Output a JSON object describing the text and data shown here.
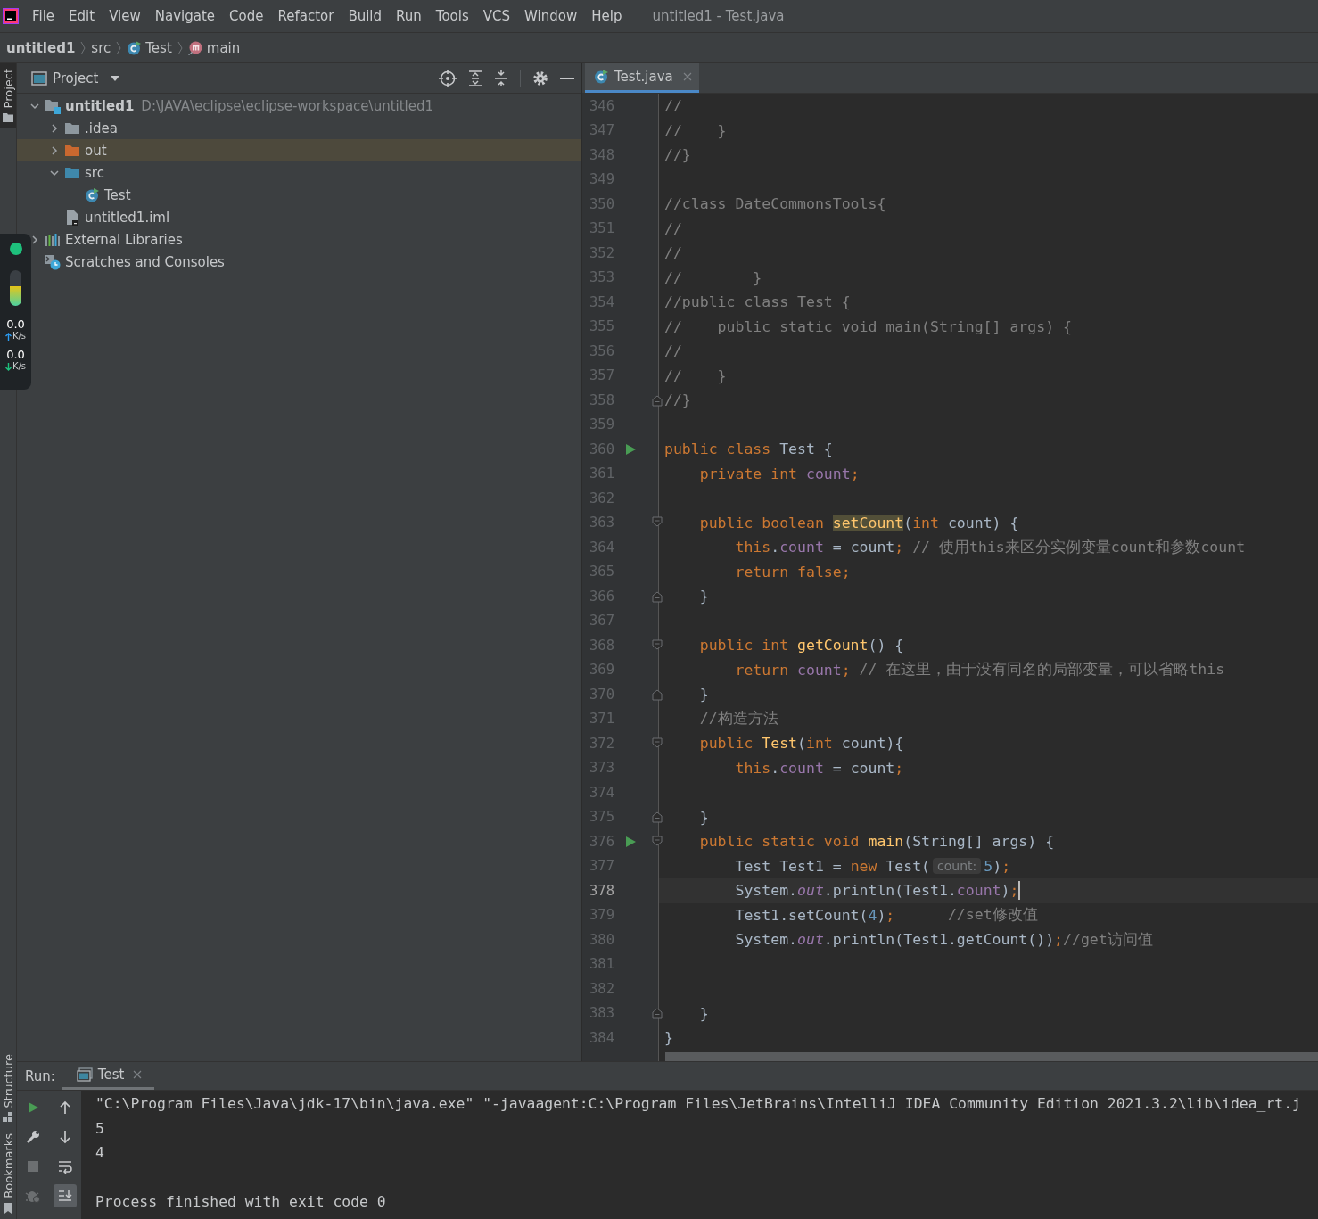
{
  "menu_bar": {
    "items": [
      "File",
      "Edit",
      "View",
      "Navigate",
      "Code",
      "Refactor",
      "Build",
      "Run",
      "Tools",
      "VCS",
      "Window",
      "Help"
    ],
    "window_title": "untitled1 - Test.java"
  },
  "breadcrumbs": [
    {
      "kind": "project",
      "label": "untitled1"
    },
    {
      "kind": "folder",
      "label": "src"
    },
    {
      "kind": "class",
      "label": "Test"
    },
    {
      "kind": "method",
      "label": "main"
    }
  ],
  "left_stripe": {
    "tabs": [
      {
        "label": "Project",
        "kind": "top",
        "selected": true
      },
      {
        "label": "Structure",
        "kind": "bottom",
        "selected": false
      },
      {
        "label": "Bookmarks",
        "kind": "bottom",
        "selected": false
      }
    ]
  },
  "project_panel": {
    "title": "Project",
    "tree": [
      {
        "kind": "module",
        "label": "untitled1",
        "path": "D:\\JAVA\\eclipse\\eclipse-workspace\\untitled1",
        "expanded": true,
        "selected": false,
        "children": [
          {
            "kind": "folder",
            "label": ".idea",
            "expanded": false,
            "selected": false
          },
          {
            "kind": "excluded-folder",
            "label": "out",
            "expanded": false,
            "selected": true
          },
          {
            "kind": "source-folder",
            "label": "src",
            "expanded": true,
            "selected": false,
            "children": [
              {
                "kind": "class",
                "label": "Test",
                "selected": false
              }
            ]
          },
          {
            "kind": "module-file",
            "label": "untitled1.iml",
            "selected": false
          }
        ]
      },
      {
        "kind": "libraries",
        "label": "External Libraries",
        "expanded": false,
        "selected": false
      },
      {
        "kind": "scratches",
        "label": "Scratches and Consoles",
        "selected": false
      }
    ]
  },
  "editor": {
    "tabs": [
      {
        "label": "Test.java",
        "selected": true
      }
    ],
    "lines": [
      {
        "number": "346",
        "current": false,
        "run": false,
        "fold_start": false,
        "fold_end": false,
        "spans": [
          {
            "kind": "comment",
            "text": "//"
          }
        ]
      },
      {
        "number": "347",
        "current": false,
        "run": false,
        "fold_start": false,
        "fold_end": false,
        "spans": [
          {
            "kind": "comment",
            "text": "//    }"
          }
        ]
      },
      {
        "number": "348",
        "current": false,
        "run": false,
        "fold_start": false,
        "fold_end": false,
        "spans": [
          {
            "kind": "comment",
            "text": "//}"
          }
        ]
      },
      {
        "number": "349",
        "current": false,
        "run": false,
        "fold_start": false,
        "fold_end": false
      },
      {
        "number": "350",
        "current": false,
        "run": false,
        "fold_start": false,
        "fold_end": false,
        "spans": [
          {
            "kind": "comment",
            "text": "//class DateCommonsTools{"
          }
        ]
      },
      {
        "number": "351",
        "current": false,
        "run": false,
        "fold_start": false,
        "fold_end": false,
        "spans": [
          {
            "kind": "comment",
            "text": "//"
          }
        ]
      },
      {
        "number": "352",
        "current": false,
        "run": false,
        "fold_start": false,
        "fold_end": false,
        "spans": [
          {
            "kind": "comment",
            "text": "//"
          }
        ]
      },
      {
        "number": "353",
        "current": false,
        "run": false,
        "fold_start": false,
        "fold_end": false,
        "spans": [
          {
            "kind": "comment",
            "text": "//        }"
          }
        ]
      },
      {
        "number": "354",
        "current": false,
        "run": false,
        "fold_start": false,
        "fold_end": false,
        "spans": [
          {
            "kind": "comment",
            "text": "//public class Test {"
          }
        ]
      },
      {
        "number": "355",
        "current": false,
        "run": false,
        "fold_start": false,
        "fold_end": false,
        "spans": [
          {
            "kind": "comment",
            "text": "//    public static void main(String[] args) {"
          }
        ]
      },
      {
        "number": "356",
        "current": false,
        "run": false,
        "fold_start": false,
        "fold_end": false,
        "spans": [
          {
            "kind": "comment",
            "text": "//"
          }
        ]
      },
      {
        "number": "357",
        "current": false,
        "run": false,
        "fold_start": false,
        "fold_end": false,
        "spans": [
          {
            "kind": "comment",
            "text": "//    }"
          }
        ]
      },
      {
        "number": "358",
        "current": false,
        "run": false,
        "fold_start": false,
        "fold_end": true,
        "spans": [
          {
            "kind": "comment",
            "text": "//}"
          }
        ]
      },
      {
        "number": "359",
        "current": false,
        "run": false,
        "fold_start": false,
        "fold_end": false
      },
      {
        "number": "360",
        "current": false,
        "run": true,
        "fold_start": false,
        "fold_end": false,
        "spans": [
          {
            "kind": "keyword",
            "text": "public class "
          },
          {
            "kind": "plain",
            "text": "Test {"
          }
        ]
      },
      {
        "number": "361",
        "current": false,
        "run": false,
        "fold_start": false,
        "fold_end": false,
        "spans": [
          {
            "kind": "keyword",
            "text": "    private int "
          },
          {
            "kind": "field",
            "text": "count"
          },
          {
            "kind": "keyword",
            "text": ";"
          }
        ]
      },
      {
        "number": "362",
        "current": false,
        "run": false,
        "fold_start": false,
        "fold_end": false
      },
      {
        "number": "363",
        "current": false,
        "run": false,
        "fold_start": true,
        "fold_end": false,
        "spans": [
          {
            "kind": "keyword",
            "text": "    public boolean "
          },
          {
            "kind": "highlight",
            "text": "setCount"
          },
          {
            "kind": "plain",
            "text": "("
          },
          {
            "kind": "keyword",
            "text": "int "
          },
          {
            "kind": "plain",
            "text": "count) {"
          }
        ]
      },
      {
        "number": "364",
        "current": false,
        "run": false,
        "fold_start": false,
        "fold_end": false,
        "spans": [
          {
            "kind": "keyword",
            "text": "        this"
          },
          {
            "kind": "plain",
            "text": "."
          },
          {
            "kind": "field",
            "text": "count"
          },
          {
            "kind": "plain",
            "text": " = count"
          },
          {
            "kind": "keyword",
            "text": ";"
          },
          {
            "kind": "comment",
            "text": " // 使用this来区分实例变量count和参数count"
          }
        ]
      },
      {
        "number": "365",
        "current": false,
        "run": false,
        "fold_start": false,
        "fold_end": false,
        "spans": [
          {
            "kind": "keyword",
            "text": "        return false;"
          }
        ]
      },
      {
        "number": "366",
        "current": false,
        "run": false,
        "fold_start": false,
        "fold_end": true,
        "spans": [
          {
            "kind": "plain",
            "text": "    }"
          }
        ]
      },
      {
        "number": "367",
        "current": false,
        "run": false,
        "fold_start": false,
        "fold_end": false
      },
      {
        "number": "368",
        "current": false,
        "run": false,
        "fold_start": true,
        "fold_end": false,
        "spans": [
          {
            "kind": "keyword",
            "text": "    public int "
          },
          {
            "kind": "declaration",
            "text": "getCount"
          },
          {
            "kind": "plain",
            "text": "() {"
          }
        ]
      },
      {
        "number": "369",
        "current": false,
        "run": false,
        "fold_start": false,
        "fold_end": false,
        "spans": [
          {
            "kind": "keyword",
            "text": "        return "
          },
          {
            "kind": "field",
            "text": "count"
          },
          {
            "kind": "keyword",
            "text": ";"
          },
          {
            "kind": "comment",
            "text": " // 在这里，由于没有同名的局部变量，可以省略this"
          }
        ]
      },
      {
        "number": "370",
        "current": false,
        "run": false,
        "fold_start": false,
        "fold_end": true,
        "spans": [
          {
            "kind": "plain",
            "text": "    }"
          }
        ]
      },
      {
        "number": "371",
        "current": false,
        "run": false,
        "fold_start": false,
        "fold_end": false,
        "spans": [
          {
            "kind": "comment",
            "text": "    //构造方法"
          }
        ]
      },
      {
        "number": "372",
        "current": false,
        "run": false,
        "fold_start": true,
        "fold_end": false,
        "spans": [
          {
            "kind": "keyword",
            "text": "    public "
          },
          {
            "kind": "declaration",
            "text": "Test"
          },
          {
            "kind": "plain",
            "text": "("
          },
          {
            "kind": "keyword",
            "text": "int "
          },
          {
            "kind": "plain",
            "text": "count){"
          }
        ]
      },
      {
        "number": "373",
        "current": false,
        "run": false,
        "fold_start": false,
        "fold_end": false,
        "spans": [
          {
            "kind": "keyword",
            "text": "        this"
          },
          {
            "kind": "plain",
            "text": "."
          },
          {
            "kind": "field",
            "text": "count"
          },
          {
            "kind": "plain",
            "text": " = count"
          },
          {
            "kind": "keyword",
            "text": ";"
          }
        ]
      },
      {
        "number": "374",
        "current": false,
        "run": false,
        "fold_start": false,
        "fold_end": false
      },
      {
        "number": "375",
        "current": false,
        "run": false,
        "fold_start": false,
        "fold_end": true,
        "spans": [
          {
            "kind": "plain",
            "text": "    }"
          }
        ]
      },
      {
        "number": "376",
        "current": false,
        "run": true,
        "fold_start": true,
        "fold_end": false,
        "spans": [
          {
            "kind": "keyword",
            "text": "    public static void "
          },
          {
            "kind": "declaration",
            "text": "main"
          },
          {
            "kind": "plain",
            "text": "(String[] args) {"
          }
        ]
      },
      {
        "number": "377",
        "current": false,
        "run": false,
        "fold_start": false,
        "fold_end": false,
        "spans": [
          {
            "kind": "plain",
            "text": "        Test Test1 = "
          },
          {
            "kind": "keyword",
            "text": "new"
          },
          {
            "kind": "plain",
            "text": " Test("
          },
          {
            "kind": "hint",
            "text": "count:"
          },
          {
            "kind": "number",
            "text": "5"
          },
          {
            "kind": "plain",
            "text": ")"
          },
          {
            "kind": "keyword",
            "text": ";"
          }
        ]
      },
      {
        "number": "378",
        "current": true,
        "run": false,
        "fold_start": false,
        "fold_end": false,
        "spans": [
          {
            "kind": "plain",
            "text": "        System."
          },
          {
            "kind": "static",
            "text": "out"
          },
          {
            "kind": "plain",
            "text": ".println(Test1."
          },
          {
            "kind": "field",
            "text": "count"
          },
          {
            "kind": "plain",
            "text": ")"
          },
          {
            "kind": "keyword",
            "text": ";"
          }
        ]
      },
      {
        "number": "379",
        "current": false,
        "run": false,
        "fold_start": false,
        "fold_end": false,
        "spans": [
          {
            "kind": "plain",
            "text": "        Test1.setCount("
          },
          {
            "kind": "number",
            "text": "4"
          },
          {
            "kind": "plain",
            "text": ")"
          },
          {
            "kind": "keyword",
            "text": ";"
          },
          {
            "kind": "comment",
            "text": "      //set修改值"
          }
        ]
      },
      {
        "number": "380",
        "current": false,
        "run": false,
        "fold_start": false,
        "fold_end": false,
        "spans": [
          {
            "kind": "plain",
            "text": "        System."
          },
          {
            "kind": "static",
            "text": "out"
          },
          {
            "kind": "plain",
            "text": ".println(Test1.getCount())"
          },
          {
            "kind": "keyword",
            "text": ";"
          },
          {
            "kind": "comment",
            "text": "//get访问值"
          }
        ]
      },
      {
        "number": "381",
        "current": false,
        "run": false,
        "fold_start": false,
        "fold_end": false
      },
      {
        "number": "382",
        "current": false,
        "run": false,
        "fold_start": false,
        "fold_end": false
      },
      {
        "number": "383",
        "current": false,
        "run": false,
        "fold_start": false,
        "fold_end": true,
        "spans": [
          {
            "kind": "plain",
            "text": "    }"
          }
        ]
      },
      {
        "number": "384",
        "current": false,
        "run": false,
        "fold_start": false,
        "fold_end": false,
        "spans": [
          {
            "kind": "plain",
            "text": "}"
          }
        ]
      }
    ]
  },
  "run_panel": {
    "title": "Run:",
    "tabs": [
      {
        "label": "Test",
        "selected": true
      }
    ],
    "toolbar": [
      {
        "kind": "rerun",
        "disabled": false,
        "selected": false
      },
      {
        "kind": "scroll-up",
        "disabled": false,
        "selected": false
      },
      {
        "kind": "settings",
        "disabled": false,
        "selected": false
      },
      {
        "kind": "scroll-down",
        "disabled": false,
        "selected": false
      },
      {
        "kind": "stop",
        "disabled": true,
        "selected": false
      },
      {
        "kind": "soft-wrap",
        "disabled": false,
        "selected": false
      },
      {
        "kind": "debug",
        "disabled": true,
        "selected": false
      },
      {
        "kind": "scroll-to-end",
        "disabled": false,
        "selected": true
      }
    ],
    "output": [
      {
        "kind": "command",
        "text": "\"C:\\Program Files\\Java\\jdk-17\\bin\\java.exe\" \"-javaagent:C:\\Program Files\\JetBrains\\IntelliJ IDEA Community Edition 2021.3.2\\lib\\idea_rt.j"
      },
      {
        "kind": "stdout",
        "text": "5"
      },
      {
        "kind": "stdout",
        "text": "4"
      },
      {
        "kind": "status",
        "text": "Process finished with exit code 0"
      }
    ]
  },
  "network_widget": {
    "level": 0.55,
    "upload": "0.0",
    "upload_unit": "K/s",
    "download": "0.0",
    "download_unit": "K/s"
  }
}
